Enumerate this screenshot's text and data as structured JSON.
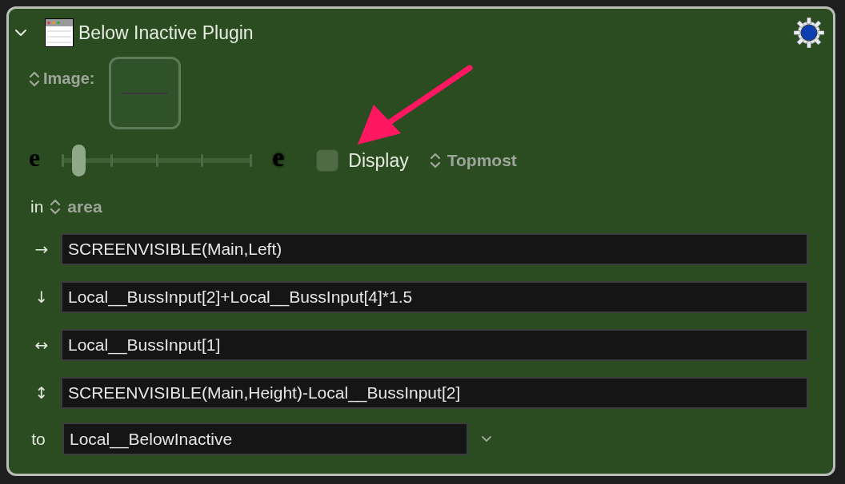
{
  "plugin": {
    "title": "Below Inactive Plugin",
    "expanded": true
  },
  "image": {
    "label": "Image:"
  },
  "opacity_slider": {
    "min_label": "e",
    "max_label": "e",
    "level": 0.09
  },
  "display": {
    "label": "Display",
    "checked": false
  },
  "layer_popup": {
    "value": "Topmost"
  },
  "position": {
    "prefix": "in",
    "value": "area"
  },
  "fields": [
    {
      "symbol": "→",
      "value": "SCREENVISIBLE(Main,Left)"
    },
    {
      "symbol": "↓",
      "value": "Local__BussInput[2]+Local__BussInput[4]*1.5"
    },
    {
      "symbol": "↔",
      "value": "Local__BussInput[1]"
    },
    {
      "symbol": "↕",
      "value": "SCREENVISIBLE(Main,Height)-Local__BussInput[2]"
    }
  ],
  "target": {
    "label": "to",
    "value": "Local__BelowInactive"
  }
}
